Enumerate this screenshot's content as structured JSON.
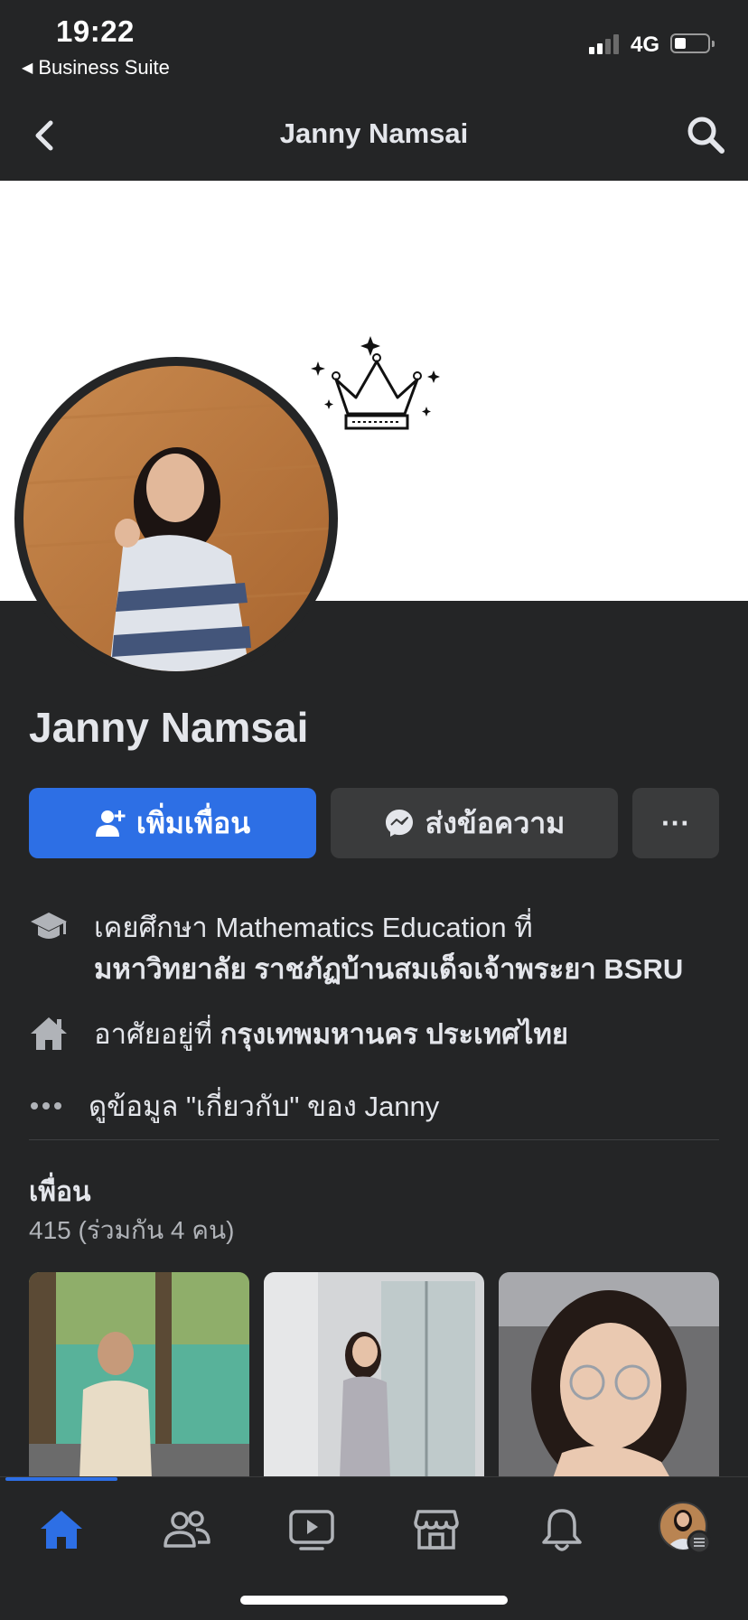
{
  "status_bar": {
    "time": "19:22",
    "back_app": "Business Suite",
    "network": "4G"
  },
  "nav": {
    "title": "Janny Namsai"
  },
  "profile": {
    "name": "Janny Namsai"
  },
  "actions": {
    "add_friend": "เพิ่มเพื่อน",
    "message": "ส่งข้อความ",
    "more": "···"
  },
  "intro": {
    "education_prefix": "เคยศึกษา Mathematics Education ที่",
    "education_school": "มหาวิทยาลัย ราชภัฏบ้านสมเด็จเจ้าพระยา BSRU",
    "lives_prefix": "อาศัยอยู่ที่",
    "lives_place": "กรุงเทพมหานคร ประเทศไทย",
    "about_link": "ดูข้อมูล \"เกี่ยวกับ\" ของ Janny"
  },
  "friends": {
    "title": "เพื่อน",
    "count": "415 (ร่วมกัน 4 คน)"
  },
  "tabs": [
    "home-icon",
    "friends-icon",
    "watch-icon",
    "marketplace-icon",
    "bell-icon",
    "profile-avatar"
  ],
  "colors": {
    "accent": "#2d6fe5",
    "background": "#242526",
    "button_gray": "#3a3b3c"
  }
}
